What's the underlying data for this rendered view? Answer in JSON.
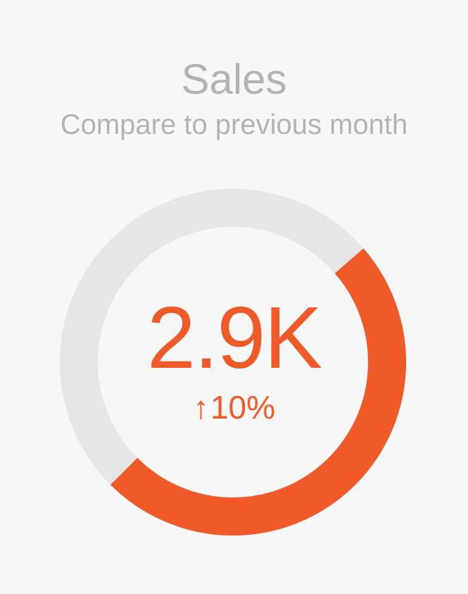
{
  "chart_data": {
    "type": "gauge",
    "title": "Sales",
    "subtitle": "Compare to previous month",
    "value_label": "2.9K",
    "change_arrow": "↑",
    "change_label": "10%",
    "progress_start_fraction": 0.136,
    "progress_end_fraction": 0.625,
    "colors": {
      "progress": "#f05a28",
      "track": "#e6e6e6",
      "background": "#f7f7f7",
      "title": "#b3b3b3"
    }
  }
}
